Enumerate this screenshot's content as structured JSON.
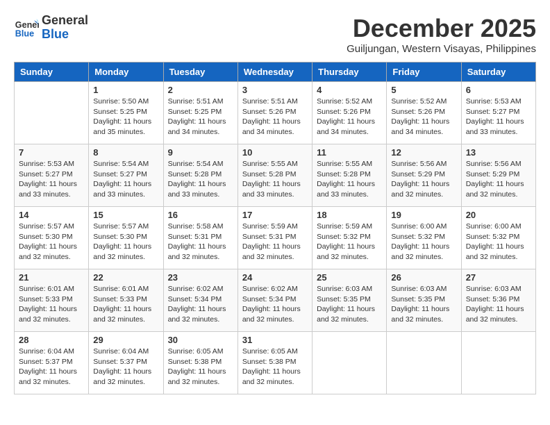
{
  "header": {
    "logo_line1": "General",
    "logo_line2": "Blue",
    "month": "December 2025",
    "location": "Guiljungan, Western Visayas, Philippines"
  },
  "weekdays": [
    "Sunday",
    "Monday",
    "Tuesday",
    "Wednesday",
    "Thursday",
    "Friday",
    "Saturday"
  ],
  "weeks": [
    [
      {
        "day": "",
        "info": ""
      },
      {
        "day": "1",
        "info": "Sunrise: 5:50 AM\nSunset: 5:25 PM\nDaylight: 11 hours\nand 35 minutes."
      },
      {
        "day": "2",
        "info": "Sunrise: 5:51 AM\nSunset: 5:25 PM\nDaylight: 11 hours\nand 34 minutes."
      },
      {
        "day": "3",
        "info": "Sunrise: 5:51 AM\nSunset: 5:26 PM\nDaylight: 11 hours\nand 34 minutes."
      },
      {
        "day": "4",
        "info": "Sunrise: 5:52 AM\nSunset: 5:26 PM\nDaylight: 11 hours\nand 34 minutes."
      },
      {
        "day": "5",
        "info": "Sunrise: 5:52 AM\nSunset: 5:26 PM\nDaylight: 11 hours\nand 34 minutes."
      },
      {
        "day": "6",
        "info": "Sunrise: 5:53 AM\nSunset: 5:27 PM\nDaylight: 11 hours\nand 33 minutes."
      }
    ],
    [
      {
        "day": "7",
        "info": "Sunrise: 5:53 AM\nSunset: 5:27 PM\nDaylight: 11 hours\nand 33 minutes."
      },
      {
        "day": "8",
        "info": "Sunrise: 5:54 AM\nSunset: 5:27 PM\nDaylight: 11 hours\nand 33 minutes."
      },
      {
        "day": "9",
        "info": "Sunrise: 5:54 AM\nSunset: 5:28 PM\nDaylight: 11 hours\nand 33 minutes."
      },
      {
        "day": "10",
        "info": "Sunrise: 5:55 AM\nSunset: 5:28 PM\nDaylight: 11 hours\nand 33 minutes."
      },
      {
        "day": "11",
        "info": "Sunrise: 5:55 AM\nSunset: 5:28 PM\nDaylight: 11 hours\nand 33 minutes."
      },
      {
        "day": "12",
        "info": "Sunrise: 5:56 AM\nSunset: 5:29 PM\nDaylight: 11 hours\nand 32 minutes."
      },
      {
        "day": "13",
        "info": "Sunrise: 5:56 AM\nSunset: 5:29 PM\nDaylight: 11 hours\nand 32 minutes."
      }
    ],
    [
      {
        "day": "14",
        "info": "Sunrise: 5:57 AM\nSunset: 5:30 PM\nDaylight: 11 hours\nand 32 minutes."
      },
      {
        "day": "15",
        "info": "Sunrise: 5:57 AM\nSunset: 5:30 PM\nDaylight: 11 hours\nand 32 minutes."
      },
      {
        "day": "16",
        "info": "Sunrise: 5:58 AM\nSunset: 5:31 PM\nDaylight: 11 hours\nand 32 minutes."
      },
      {
        "day": "17",
        "info": "Sunrise: 5:59 AM\nSunset: 5:31 PM\nDaylight: 11 hours\nand 32 minutes."
      },
      {
        "day": "18",
        "info": "Sunrise: 5:59 AM\nSunset: 5:32 PM\nDaylight: 11 hours\nand 32 minutes."
      },
      {
        "day": "19",
        "info": "Sunrise: 6:00 AM\nSunset: 5:32 PM\nDaylight: 11 hours\nand 32 minutes."
      },
      {
        "day": "20",
        "info": "Sunrise: 6:00 AM\nSunset: 5:32 PM\nDaylight: 11 hours\nand 32 minutes."
      }
    ],
    [
      {
        "day": "21",
        "info": "Sunrise: 6:01 AM\nSunset: 5:33 PM\nDaylight: 11 hours\nand 32 minutes."
      },
      {
        "day": "22",
        "info": "Sunrise: 6:01 AM\nSunset: 5:33 PM\nDaylight: 11 hours\nand 32 minutes."
      },
      {
        "day": "23",
        "info": "Sunrise: 6:02 AM\nSunset: 5:34 PM\nDaylight: 11 hours\nand 32 minutes."
      },
      {
        "day": "24",
        "info": "Sunrise: 6:02 AM\nSunset: 5:34 PM\nDaylight: 11 hours\nand 32 minutes."
      },
      {
        "day": "25",
        "info": "Sunrise: 6:03 AM\nSunset: 5:35 PM\nDaylight: 11 hours\nand 32 minutes."
      },
      {
        "day": "26",
        "info": "Sunrise: 6:03 AM\nSunset: 5:35 PM\nDaylight: 11 hours\nand 32 minutes."
      },
      {
        "day": "27",
        "info": "Sunrise: 6:03 AM\nSunset: 5:36 PM\nDaylight: 11 hours\nand 32 minutes."
      }
    ],
    [
      {
        "day": "28",
        "info": "Sunrise: 6:04 AM\nSunset: 5:37 PM\nDaylight: 11 hours\nand 32 minutes."
      },
      {
        "day": "29",
        "info": "Sunrise: 6:04 AM\nSunset: 5:37 PM\nDaylight: 11 hours\nand 32 minutes."
      },
      {
        "day": "30",
        "info": "Sunrise: 6:05 AM\nSunset: 5:38 PM\nDaylight: 11 hours\nand 32 minutes."
      },
      {
        "day": "31",
        "info": "Sunrise: 6:05 AM\nSunset: 5:38 PM\nDaylight: 11 hours\nand 32 minutes."
      },
      {
        "day": "",
        "info": ""
      },
      {
        "day": "",
        "info": ""
      },
      {
        "day": "",
        "info": ""
      }
    ]
  ]
}
